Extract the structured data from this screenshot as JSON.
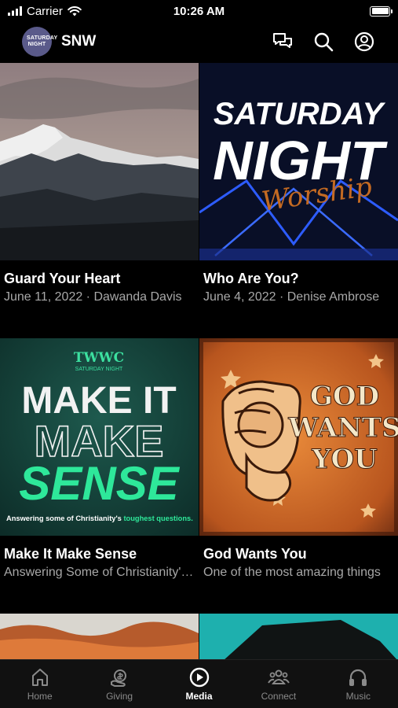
{
  "status": {
    "carrier": "Carrier",
    "time": "10:26 AM",
    "battery_level": 1.0
  },
  "header": {
    "logo_text": "SATURDAY NIGHT",
    "title": "SNW"
  },
  "cards": [
    {
      "title": "Guard Your Heart",
      "subtitle": "June 11, 2022 · Dawanda Davis"
    },
    {
      "title": "Who Are You?",
      "subtitle": "June 4, 2022 · Denise Ambrose"
    },
    {
      "title": "Make It Make Sense",
      "subtitle": "Answering Some of Christianity's toughest questions"
    },
    {
      "title": "God Wants You",
      "subtitle": "One of  the most amazing things"
    }
  ],
  "art": {
    "snw_line1": "SATURDAY",
    "snw_line2": "NIGHT",
    "snw_script": "Worship",
    "mims_brand": "TWWC",
    "mims_brand_sub": "SATURDAY NIGHT",
    "mims_line1": "MAKE IT",
    "mims_line2": "MAKE",
    "mims_line3": "SENSE",
    "mims_caption_pre": "Answering some of Christianity's ",
    "mims_caption_em": "toughest questions.",
    "gwy_line1": "GOD",
    "gwy_line2": "WANTS",
    "gwy_line3": "YOU"
  },
  "tabs": [
    {
      "label": "Home",
      "icon": "home-icon"
    },
    {
      "label": "Giving",
      "icon": "giving-icon"
    },
    {
      "label": "Media",
      "icon": "play-icon",
      "active": true
    },
    {
      "label": "Connect",
      "icon": "people-icon"
    },
    {
      "label": "Music",
      "icon": "headphones-icon"
    }
  ]
}
